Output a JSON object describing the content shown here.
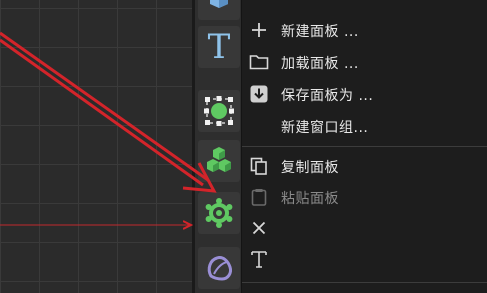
{
  "menu": {
    "items": [
      {
        "icon": "plus-icon",
        "label": "新建面板 ...",
        "enabled": true
      },
      {
        "icon": "folder-icon",
        "label": "加载面板 ...",
        "enabled": true
      },
      {
        "icon": "download-icon",
        "label": "保存面板为 ...",
        "enabled": true
      },
      {
        "icon": "",
        "label": "新建窗口组...",
        "enabled": true
      },
      {
        "icon": "copy-icon",
        "label": "复制面板",
        "enabled": true
      },
      {
        "icon": "clipboard-icon",
        "label": "粘贴面板",
        "enabled": false
      },
      {
        "icon": "close-icon",
        "label": "",
        "enabled": true
      },
      {
        "icon": "text-icon",
        "label": "",
        "enabled": true
      }
    ]
  },
  "toolbar": {
    "tools": [
      {
        "icon": "cube-icon"
      },
      {
        "icon": "text-tool-icon",
        "label": "T"
      },
      {
        "icon": "sphere-select-icon"
      },
      {
        "icon": "cubes-stack-icon"
      },
      {
        "icon": "gear-node-icon"
      },
      {
        "icon": "shape-icon"
      }
    ]
  },
  "colors": {
    "accent_green": "#5fc962",
    "annotation_red": "#d3242a",
    "text_tool_blue": "#8fc3ea",
    "shape_purple": "#9a8fd6"
  }
}
